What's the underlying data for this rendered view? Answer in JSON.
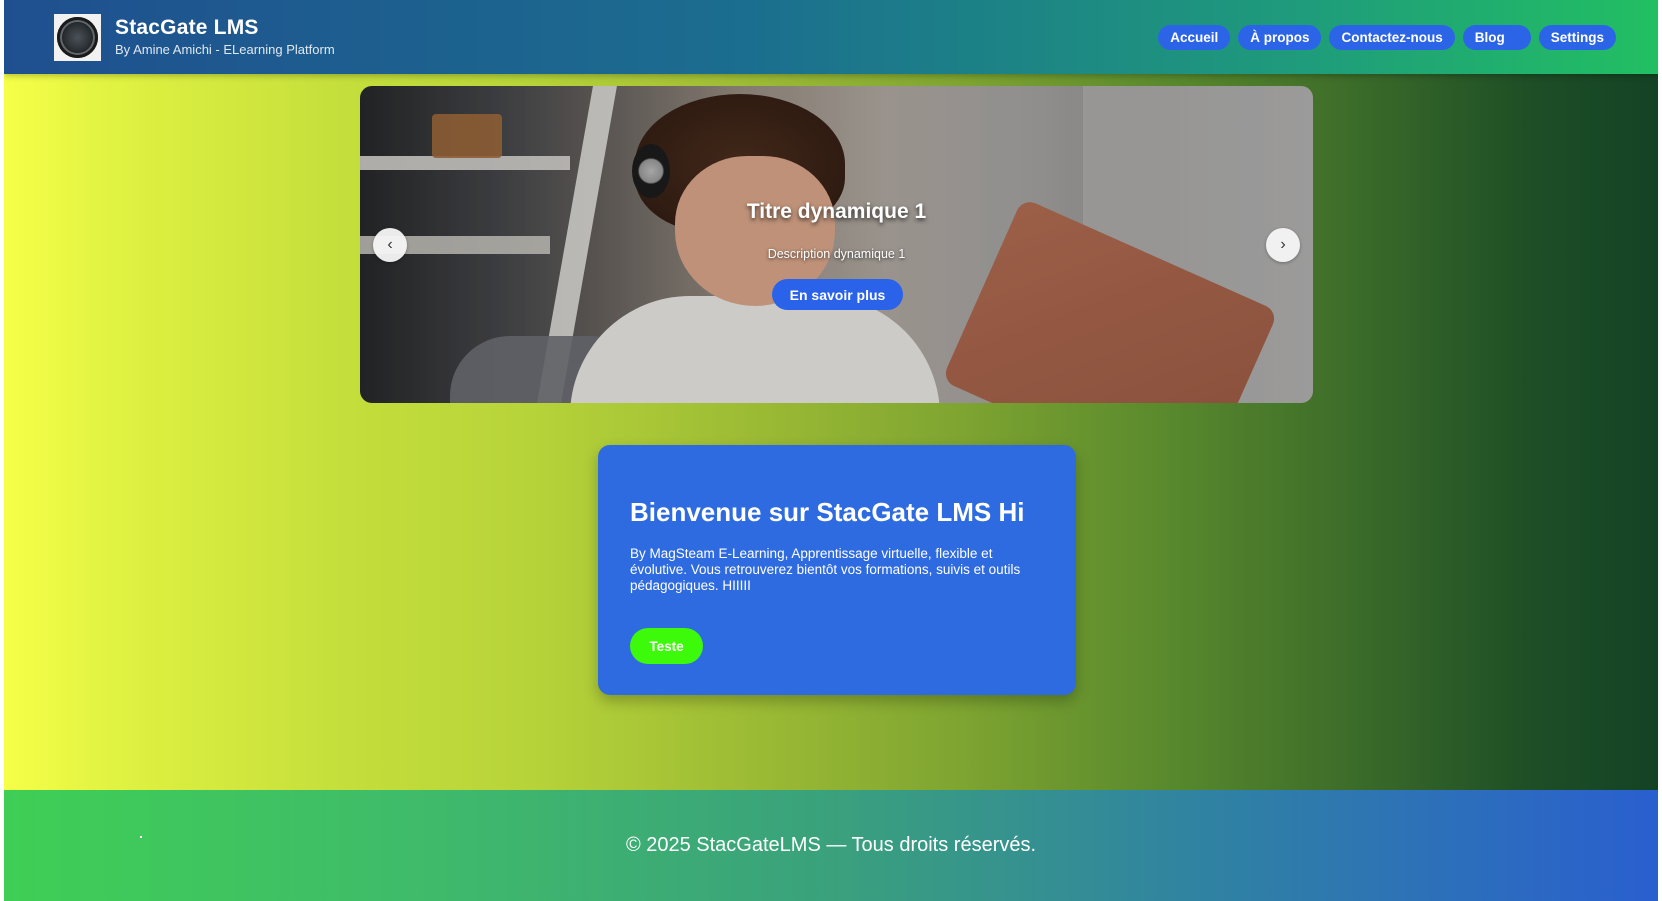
{
  "header": {
    "title": "StacGate LMS",
    "subtitle": "By Amine Amichi - ELearning Platform",
    "logo_icon": "logo-icon"
  },
  "nav": {
    "items": [
      {
        "label": "Accueil"
      },
      {
        "label": "À propos"
      },
      {
        "label": "Contactez-nous"
      },
      {
        "label": "Blog"
      },
      {
        "label": "Settings"
      }
    ]
  },
  "carousel": {
    "slide_title": "Titre dynamique 1",
    "slide_description": "Description dynamique 1",
    "cta_label": "En savoir plus",
    "prev_icon": "‹",
    "next_icon": "›"
  },
  "welcome": {
    "title": "Bienvenue sur StacGate LMS Hi",
    "text": "By MagSteam E-Learning, Apprentissage virtuelle, flexible et évolutive. Vous retrouverez bientôt vos formations, suivis et outils pédagogiques. HIIIII",
    "button_label": "Teste"
  },
  "footer": {
    "text": "© 2025 StacGateLMS — Tous droits réservés."
  },
  "colors": {
    "nav_button": "#2c64e8",
    "card_background": "#2f6be0",
    "card_button": "#3dfa0b"
  }
}
